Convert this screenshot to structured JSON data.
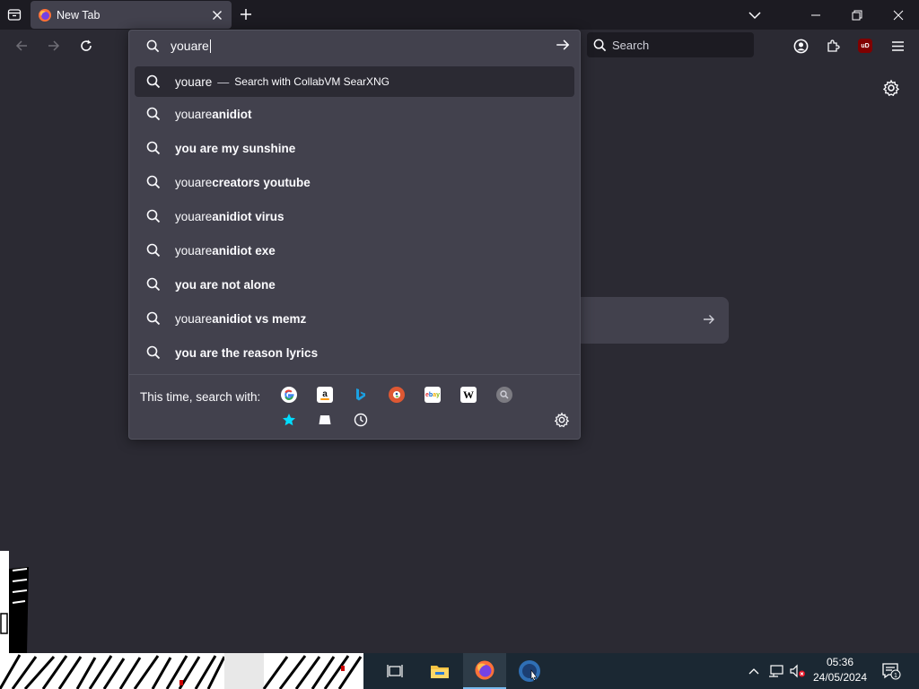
{
  "browser": {
    "tab_title": "New Tab",
    "search_bar_placeholder": "Search"
  },
  "urlbar": {
    "typed": "youare",
    "first_result": {
      "query": "youare",
      "dash": "—",
      "action": "Search with CollabVM SearXNG"
    },
    "suggestions": [
      {
        "plain": "youare",
        "bold": "anidiot"
      },
      {
        "plain": "",
        "bold": "you are my sunshine"
      },
      {
        "plain": "youare",
        "bold": "creators youtube"
      },
      {
        "plain": "youare",
        "bold": "anidiot virus"
      },
      {
        "plain": "youare",
        "bold": "anidiot exe"
      },
      {
        "plain": "",
        "bold": "you are not alone"
      },
      {
        "plain": "youare",
        "bold": "anidiot vs memz"
      },
      {
        "plain": "",
        "bold": "you are the reason lyrics"
      }
    ],
    "oneoff_label": "This time, search with:",
    "engines": [
      "google",
      "amazon",
      "bing",
      "duckduckgo",
      "ebay",
      "wikipedia",
      "collabvm-searxng"
    ],
    "modes": [
      "bookmarks",
      "tabs",
      "history"
    ]
  },
  "extensions": {
    "ublock_label": "uD"
  },
  "taskbar": {
    "time": "05:36",
    "date": "24/05/2024",
    "notification_count": "1"
  },
  "colors": {
    "background": "#2b2a33",
    "popup": "#42414d",
    "tabstrip": "#1c1b22",
    "taskbar": "#1b2833",
    "accent": "#00ddff"
  }
}
